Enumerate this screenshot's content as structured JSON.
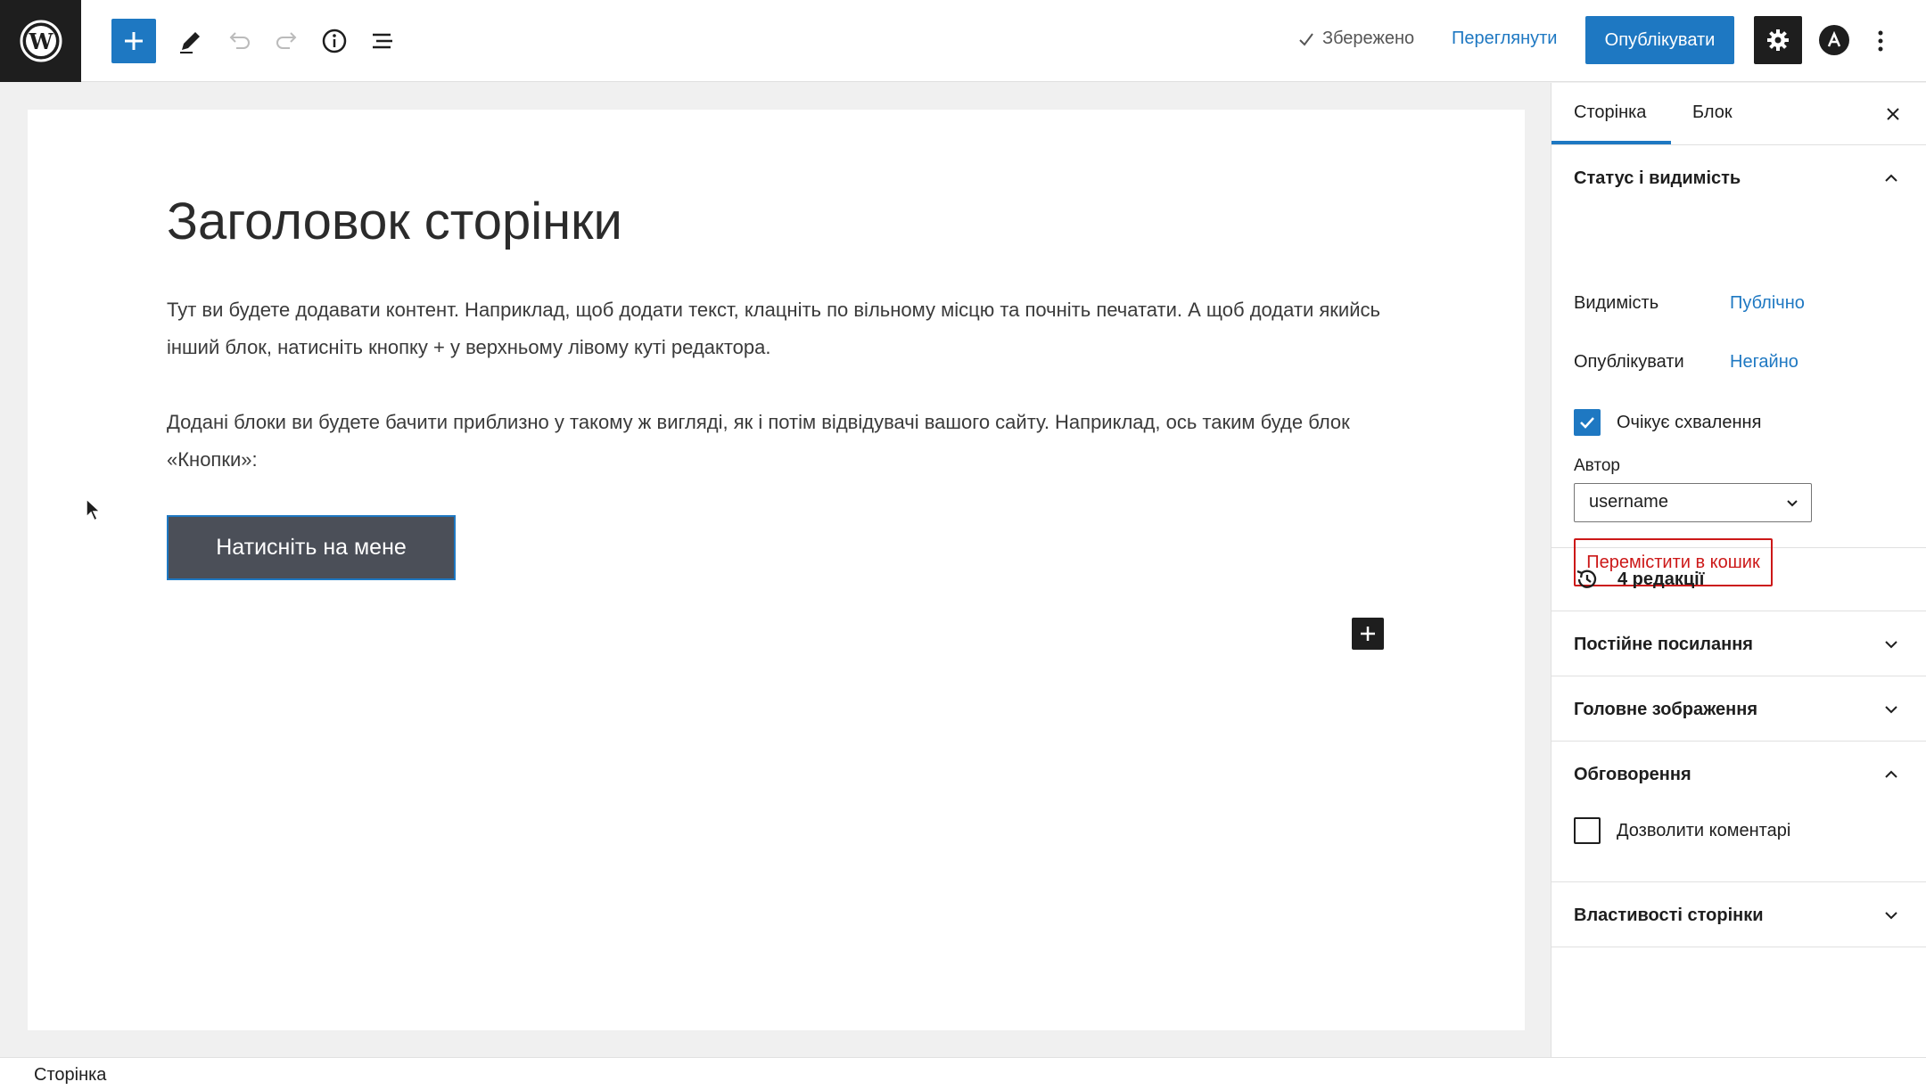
{
  "toolbar": {
    "saved_label": "Збережено",
    "preview_label": "Переглянути",
    "publish_label": "Опублікувати"
  },
  "canvas": {
    "title": "Заголовок сторінки",
    "paragraph1": "Тут ви будете додавати контент. Наприклад, щоб додати текст, клацніть по вільному місцю та почніть печатати. А щоб додати якийсь інший блок, натисніть кнопку + у верхньому лівому куті редактора.",
    "paragraph2": "Додані блоки ви будете бачити приблизно у такому ж вигляді, як і потім відвідувачі вашого сайту. Наприклад, ось таким буде блок «Кнопки»:",
    "button_label": "Натисніть на мене"
  },
  "sidebar": {
    "tabs": [
      "Сторінка",
      "Блок"
    ],
    "status_panel": {
      "title": "Статус і видимість",
      "visibility_label": "Видимість",
      "visibility_value": "Публічно",
      "publish_label": "Опублікувати",
      "publish_value": "Негайно",
      "pending_label": "Очікує схвалення",
      "pending_checked": true,
      "author_label": "Автор",
      "author_value": "username",
      "trash_label": "Перемістити в кошик"
    },
    "revisions_label": "4 редакції",
    "permalink_label": "Постійне посилання",
    "featured_image_label": "Головне зображення",
    "discussion": {
      "title": "Обговорення",
      "allow_comments_label": "Дозволити коментарі",
      "allow_comments_checked": false
    },
    "page_attributes_label": "Властивості сторінки"
  },
  "statusbar": {
    "breadcrumb": "Сторінка"
  },
  "colors": {
    "accent": "#1e78c2",
    "dark": "#1e1e1e",
    "danger": "#cc1818",
    "button_bg": "#4b4f58"
  }
}
